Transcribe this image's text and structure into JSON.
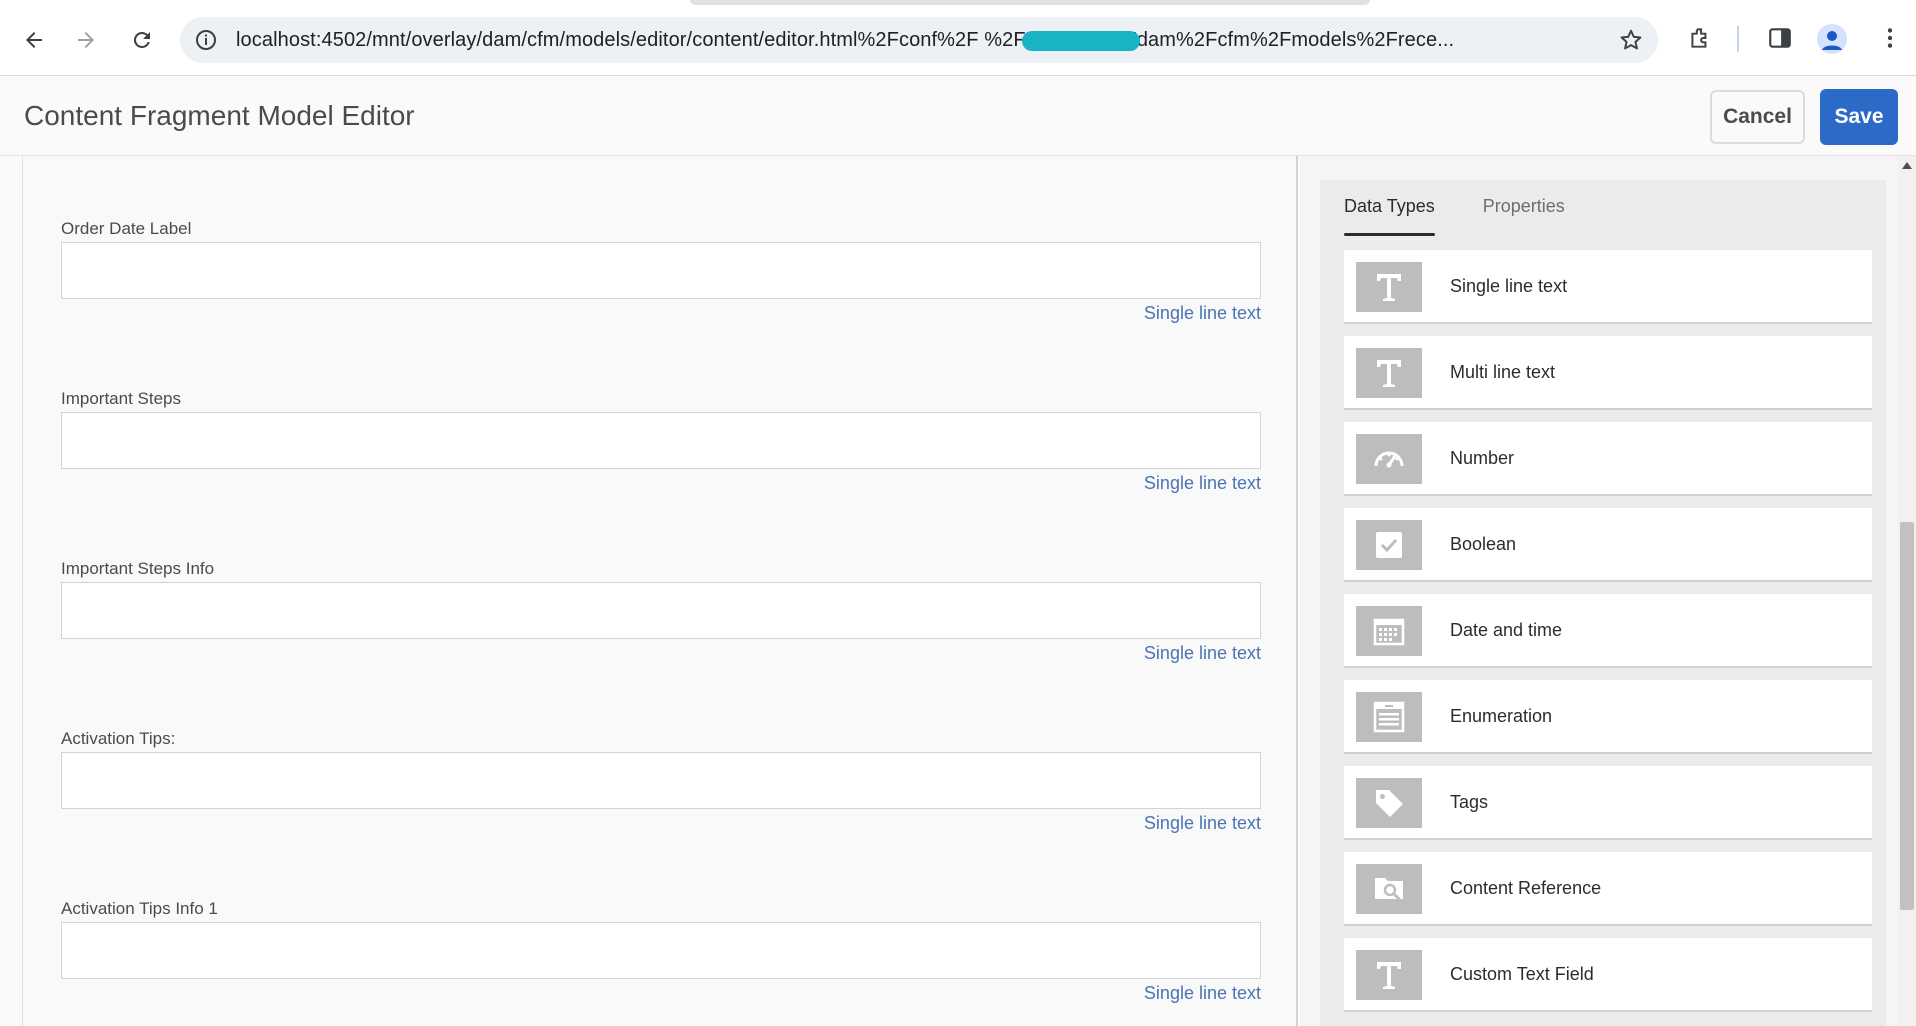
{
  "browser": {
    "url": "localhost:4502/mnt/overlay/dam/cfm/models/editor/content/editor.html%2Fconf%2F                  %2Fsettings%2Fdam%2Fcfm%2Fmodels%2Frece..."
  },
  "header": {
    "title": "Content Fragment Model Editor",
    "cancel_label": "Cancel",
    "save_label": "Save",
    "save_color": "#2c6ac7"
  },
  "form": {
    "fields": [
      {
        "label": "Order Date Label",
        "type": "Single line text"
      },
      {
        "label": "Important Steps",
        "type": "Single line text"
      },
      {
        "label": "Important Steps Info",
        "type": "Single line text"
      },
      {
        "label": "Activation Tips:",
        "type": "Single line text"
      },
      {
        "label": "Activation Tips Info 1",
        "type": "Single line text"
      }
    ]
  },
  "sidebar": {
    "tabs": [
      {
        "label": "Data Types",
        "active": true
      },
      {
        "label": "Properties",
        "active": false
      }
    ],
    "data_types": [
      {
        "label": "Single line text",
        "icon": "text-icon"
      },
      {
        "label": "Multi line text",
        "icon": "text-icon"
      },
      {
        "label": "Number",
        "icon": "gauge-icon"
      },
      {
        "label": "Boolean",
        "icon": "checkbox-icon"
      },
      {
        "label": "Date and time",
        "icon": "calendar-icon"
      },
      {
        "label": "Enumeration",
        "icon": "list-icon"
      },
      {
        "label": "Tags",
        "icon": "tag-icon"
      },
      {
        "label": "Content Reference",
        "icon": "folder-search-icon"
      },
      {
        "label": "Custom Text Field",
        "icon": "text-icon"
      }
    ]
  }
}
